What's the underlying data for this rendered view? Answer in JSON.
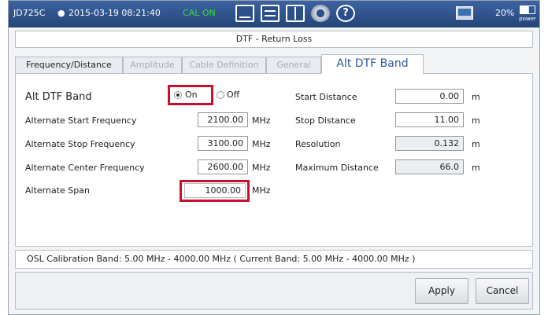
{
  "status_bar": {
    "model": "JD725C",
    "datetime": "2015-03-19 08:21:40",
    "cal_status": "CAL ON",
    "battery": "20%",
    "power_label": "power",
    "icons": [
      "clock-icon",
      "screen-icon",
      "list-icon",
      "book-icon",
      "gear-icon",
      "help-icon",
      "monitor-icon",
      "power-icon"
    ]
  },
  "window_title": "DTF - Return Loss",
  "tabs": [
    {
      "label": "Frequency/Distance",
      "state": "enabled"
    },
    {
      "label": "Amplitude",
      "state": "disabled"
    },
    {
      "label": "Cable Definition",
      "state": "disabled"
    },
    {
      "label": "General",
      "state": "disabled"
    },
    {
      "label": "Alt DTF Band",
      "state": "active"
    }
  ],
  "alt_dtf_band": {
    "label": "Alt DTF Band",
    "on_label": "On",
    "off_label": "Off",
    "selected": "On"
  },
  "left_fields": [
    {
      "label": "Alternate Start Frequency",
      "value": "2100.00",
      "unit": "MHz"
    },
    {
      "label": "Alternate Stop Frequency",
      "value": "3100.00",
      "unit": "MHz"
    },
    {
      "label": "Alternate Center Frequency",
      "value": "2600.00",
      "unit": "MHz"
    },
    {
      "label": "Alternate Span",
      "value": "1000.00",
      "unit": "MHz"
    }
  ],
  "right_fields": [
    {
      "label": "Start Distance",
      "value": "0.00",
      "unit": "m",
      "readonly": false
    },
    {
      "label": "Stop Distance",
      "value": "11.00",
      "unit": "m",
      "readonly": false
    },
    {
      "label": "Resolution",
      "value": "0.132",
      "unit": "m",
      "readonly": true
    },
    {
      "label": "Maximum Distance",
      "value": "66.0",
      "unit": "m",
      "readonly": true
    }
  ],
  "info_text": "OSL Calibration Band: 5.00 MHz - 4000.00 MHz ( Current Band: 5.00 MHz - 4000.00 MHz )",
  "buttons": {
    "apply": "Apply",
    "cancel": "Cancel"
  },
  "colors": {
    "status_bar": "#2f5596",
    "cal_on": "#33e033",
    "highlight": "#c8102e",
    "active_tab_text": "#2a5aa0"
  }
}
